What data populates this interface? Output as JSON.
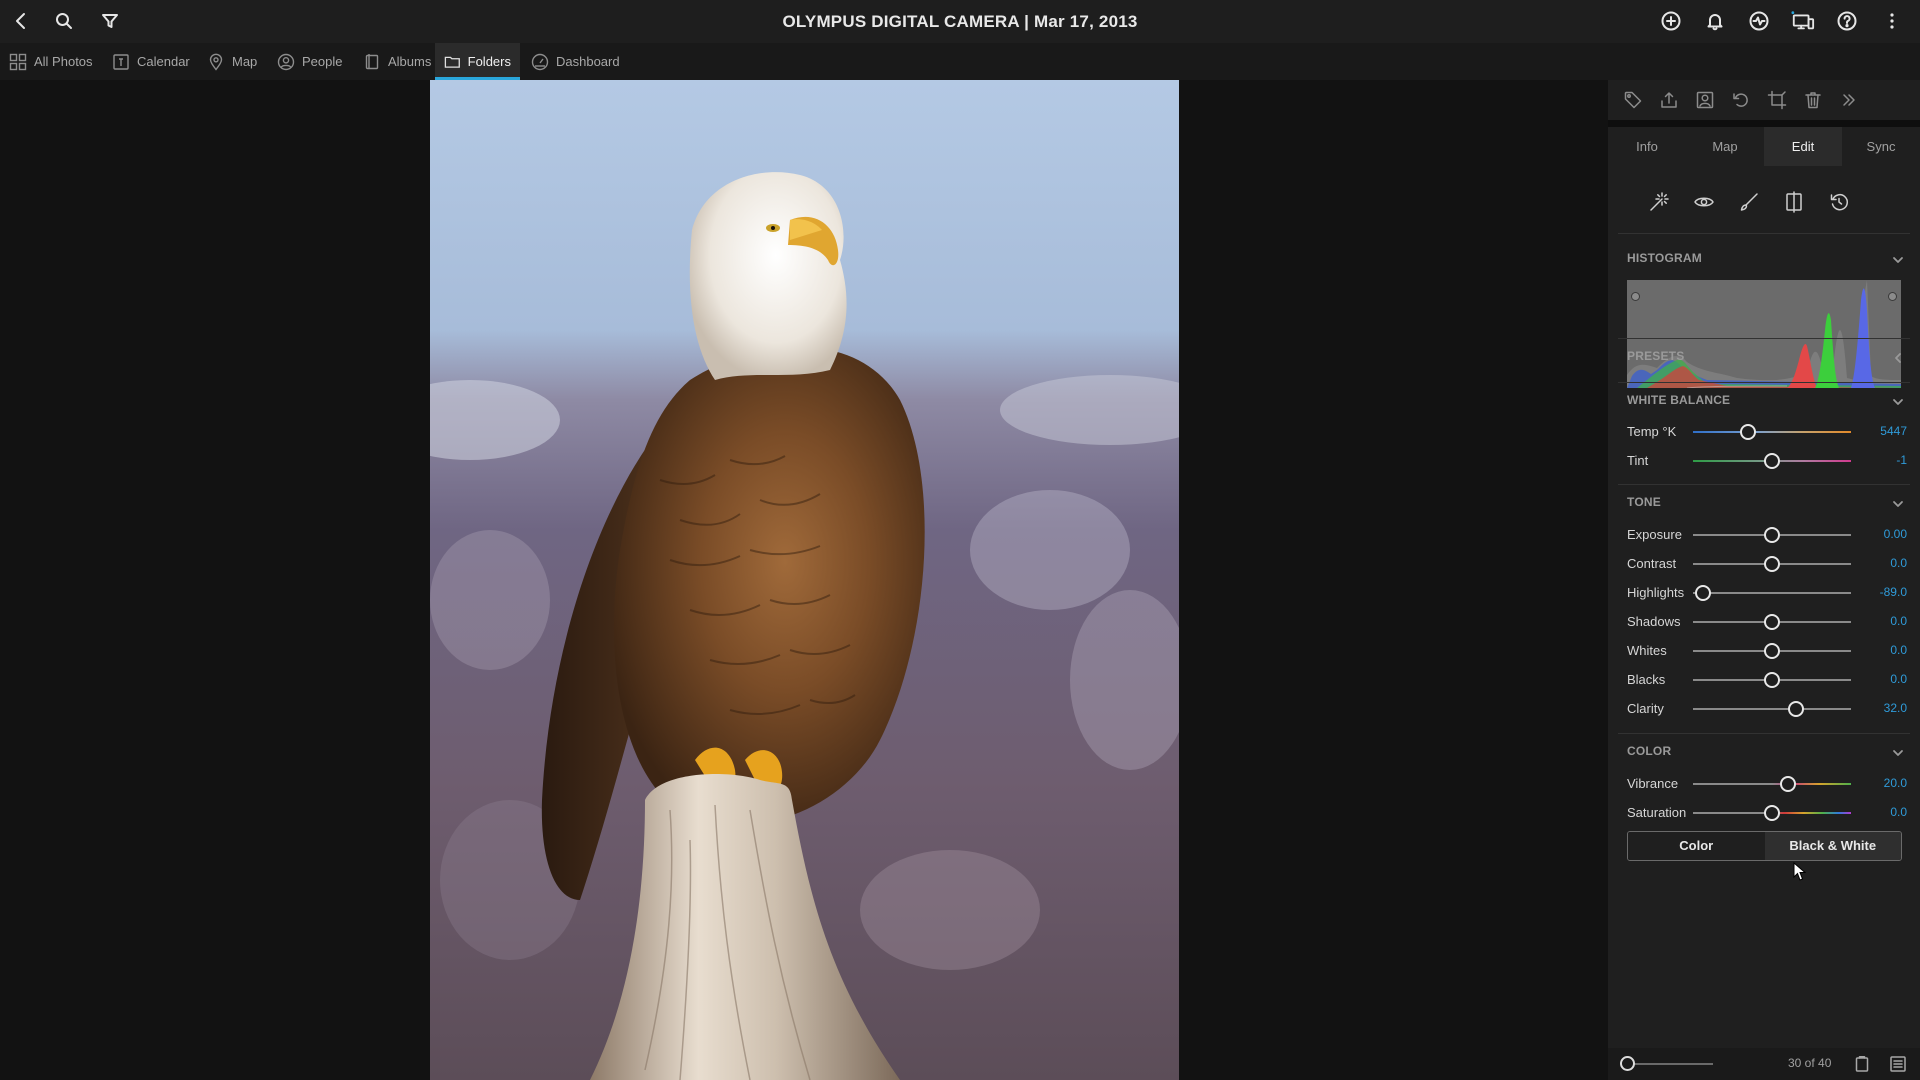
{
  "topbar": {
    "title": "OLYMPUS DIGITAL CAMERA | Mar 17, 2013",
    "left_icons": [
      "back-icon",
      "search-icon",
      "filter-icon"
    ],
    "right_icons": [
      "add-icon",
      "bell-icon",
      "activity-icon",
      "display-icon",
      "help-icon",
      "more-icon"
    ]
  },
  "nav": {
    "items": [
      {
        "label": "All Photos",
        "icon": "grid-icon"
      },
      {
        "label": "Calendar",
        "icon": "calendar-icon"
      },
      {
        "label": "Map",
        "icon": "pin-icon"
      },
      {
        "label": "People",
        "icon": "person-icon"
      },
      {
        "label": "Albums",
        "icon": "album-icon"
      },
      {
        "label": "Folders",
        "icon": "folder-icon",
        "active": true
      },
      {
        "label": "Dashboard",
        "icon": "dashboard-icon"
      }
    ],
    "accent": "#2aa7dc"
  },
  "panel": {
    "toolbar_icons": [
      "tag-icon",
      "share-icon",
      "people-tag-icon",
      "rotate-icon",
      "crop-icon",
      "trash-icon",
      "expand-icon"
    ],
    "tabs": [
      "Info",
      "Map",
      "Edit",
      "Sync"
    ],
    "active_tab": "Edit",
    "edit_tools": [
      "magic-wand-icon",
      "eye-icon",
      "brush-icon",
      "compare-icon",
      "revert-icon"
    ],
    "sections": {
      "histogram": "HISTOGRAM",
      "presets": "PRESETS",
      "white_balance": "WHITE BALANCE",
      "tone": "TONE",
      "color": "COLOR"
    },
    "white_balance": [
      {
        "label": "Temp °K",
        "value": "5447",
        "position": 0.35
      },
      {
        "label": "Tint",
        "value": "-1",
        "position": 0.5
      }
    ],
    "tone": [
      {
        "label": "Exposure",
        "value": "0.00",
        "position": 0.5
      },
      {
        "label": "Contrast",
        "value": "0.0",
        "position": 0.5
      },
      {
        "label": "Highlights",
        "value": "-89.0",
        "position": 0.065
      },
      {
        "label": "Shadows",
        "value": "0.0",
        "position": 0.5
      },
      {
        "label": "Whites",
        "value": "0.0",
        "position": 0.5
      },
      {
        "label": "Blacks",
        "value": "0.0",
        "position": 0.5
      },
      {
        "label": "Clarity",
        "value": "32.0",
        "position": 0.655
      }
    ],
    "color": [
      {
        "label": "Vibrance",
        "value": "20.0",
        "position": 0.6
      },
      {
        "label": "Saturation",
        "value": "0.0",
        "position": 0.5
      }
    ],
    "mode_buttons": [
      "Color",
      "Black & White"
    ],
    "active_mode": "Color",
    "footer": {
      "count": "30 of 40",
      "zoom_position": 0
    },
    "value_color": "#2f9bd9"
  }
}
